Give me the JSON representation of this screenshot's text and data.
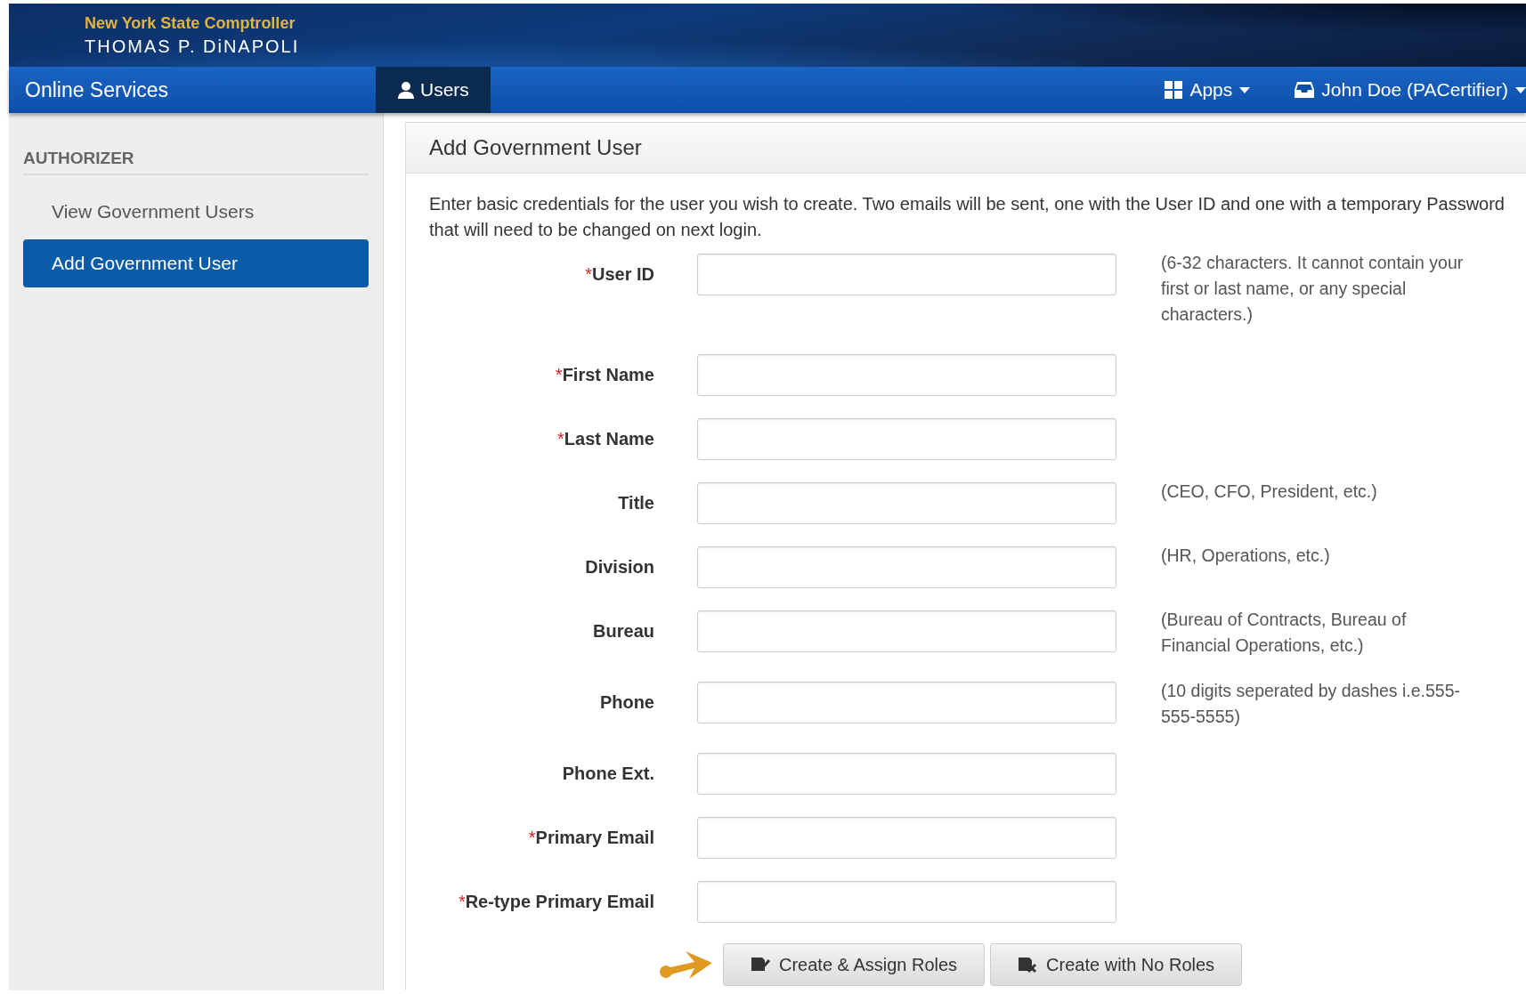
{
  "brand": {
    "office": "New York State Comptroller",
    "name": "THOMAS P. DiNAPOLI"
  },
  "navbar": {
    "title": "Online Services",
    "tabs": [
      {
        "label": "Users",
        "selected": true
      }
    ],
    "apps": "Apps",
    "user": "John Doe (PACertifier)"
  },
  "sidebar": {
    "heading": "AUTHORIZER",
    "items": [
      {
        "label": "View Government Users",
        "selected": false
      },
      {
        "label": "Add Government User",
        "selected": true
      }
    ]
  },
  "panel": {
    "title": "Add Government User",
    "intro": "Enter basic credentials for the user you wish to create. Two emails will be sent, one with the User ID and one with a temporary Password that will need to be changed on next login.",
    "fields": [
      {
        "label": "User ID",
        "marker": "*",
        "help": "(6-32 characters. It cannot contain your first or last name, or any special characters.)"
      },
      {
        "label": "First Name",
        "marker": "*"
      },
      {
        "label": "Last Name",
        "marker": "*"
      },
      {
        "label": "Title",
        "help": "(CEO, CFO, President, etc.)"
      },
      {
        "label": "Division",
        "help": "(HR, Operations, etc.)"
      },
      {
        "label": "Bureau",
        "help": "(Bureau of Contracts, Bureau of Financial Operations, etc.)"
      },
      {
        "label": "Phone",
        "help": "(10 digits seperated by dashes i.e.555-555-5555)"
      },
      {
        "label": "Phone Ext."
      },
      {
        "label": "Primary Email",
        "marker": "*"
      },
      {
        "label": "Re-type Primary Email",
        "marker": "*"
      }
    ],
    "buttons": [
      {
        "label": "Create & Assign Roles",
        "kind": "assign"
      },
      {
        "label": "Create with No Roles",
        "kind": "none"
      }
    ]
  }
}
